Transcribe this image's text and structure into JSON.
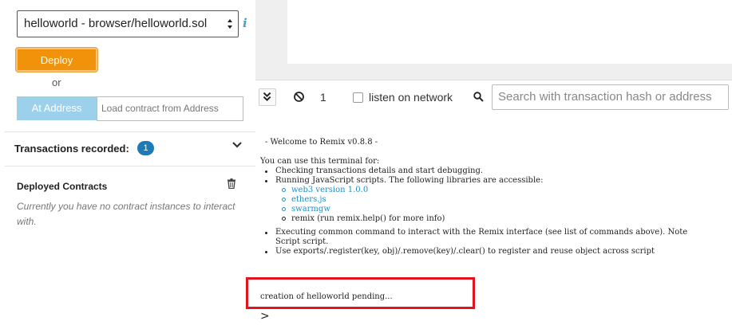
{
  "run_panel": {
    "contract_select": {
      "selected": "helloworld - browser/helloworld.sol"
    },
    "deploy_label": "Deploy",
    "or_label": "or",
    "at_address_label": "At Address",
    "at_address_placeholder": "Load contract from Address",
    "transactions_recorded": {
      "label": "Transactions recorded:",
      "count": "1"
    },
    "deployed_contracts": {
      "title": "Deployed Contracts",
      "empty_message": "Currently you have no contract instances to interact with."
    }
  },
  "terminal": {
    "pending_count": "1",
    "listen_label": "listen on network",
    "listen_checked": false,
    "search_placeholder": "Search with transaction hash or address",
    "welcome": "- Welcome to Remix v0.8.8 -",
    "intro": "You can use this terminal for:",
    "bullet_1": "Checking transactions details and start debugging.",
    "bullet_2": "Running JavaScript scripts. The following libraries are accessible:",
    "libraries": [
      "web3 version 1.0.0",
      "ethers.js",
      "swarmgw"
    ],
    "library_remix": "remix (run remix.help() for more info)",
    "bullet_3_line1": "Executing common command to interact with the Remix interface (see list of commands above). Note",
    "bullet_3_line2": "Script script.",
    "bullet_4": "Use exports/.register(key, obj)/.remove(key)/.clear() to register and reuse object across script",
    "pending_message": "creation of helloworld pending...",
    "prompt": ">"
  },
  "colors": {
    "deploy": "#f0930a",
    "at_address": "#9dd0ea",
    "badge": "#1c7bb6",
    "link": "#1f8ec3",
    "highlight": "#e2141d"
  }
}
